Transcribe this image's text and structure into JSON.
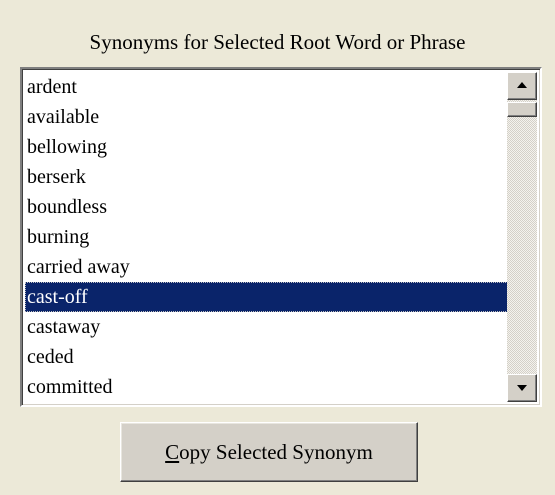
{
  "header": {
    "title": "Synonyms for Selected Root Word or Phrase"
  },
  "synonyms": {
    "items": [
      "ardent",
      "available",
      "bellowing",
      "berserk",
      "boundless",
      "burning",
      "carried away",
      "cast-off",
      "castaway",
      "ceded",
      "committed"
    ],
    "selected": "cast-off"
  },
  "scrollbar": {
    "up_icon": "up-arrow",
    "down_icon": "down-arrow"
  },
  "copy_button": {
    "mnemonic": "C",
    "label_rest": "opy Selected Synonym"
  },
  "colors": {
    "dialog_bg": "#ece9d8",
    "selection_bg": "#0a246a",
    "selection_fg": "#ffffff"
  }
}
